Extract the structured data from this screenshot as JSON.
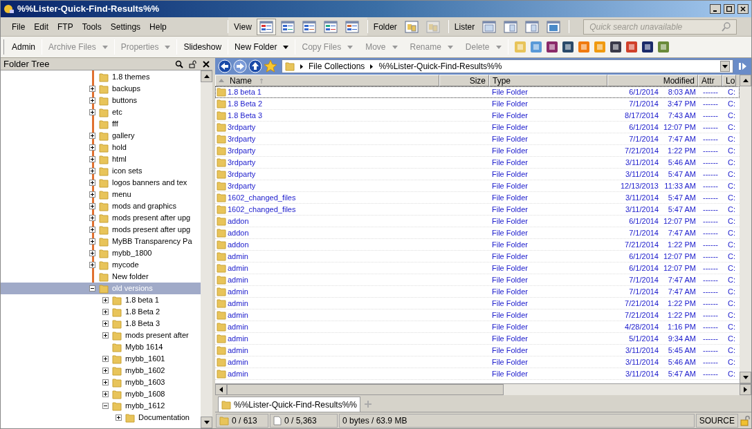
{
  "window": {
    "title": "%%Lister-Quick-Find-Results%%"
  },
  "menu": [
    "File",
    "Edit",
    "FTP",
    "Tools",
    "Settings",
    "Help"
  ],
  "view_group": {
    "label": "View",
    "modes": [
      {
        "selected": true
      },
      {
        "selected": false
      },
      {
        "selected": false
      },
      {
        "selected": false
      },
      {
        "selected": false
      }
    ]
  },
  "folder_group": {
    "label": "Folder",
    "buttons": [
      {
        "disabled": false
      },
      {
        "disabled": true
      }
    ]
  },
  "lister_group": {
    "label": "Lister"
  },
  "search": {
    "placeholder": "Quick search unavailable"
  },
  "toolbar": [
    {
      "label": "Admin",
      "disabled": false,
      "dropdown": false
    },
    {
      "label": "Archive Files",
      "disabled": true,
      "dropdown": true
    },
    {
      "label": "Properties",
      "disabled": true,
      "dropdown": true
    },
    {
      "label": "Slideshow",
      "disabled": false,
      "dropdown": false
    },
    {
      "label": "New Folder",
      "disabled": false,
      "dropdown": true
    },
    {
      "label": "Copy Files",
      "disabled": true,
      "dropdown": true
    },
    {
      "label": "Move",
      "disabled": true,
      "dropdown": true
    },
    {
      "label": "Rename",
      "disabled": true,
      "dropdown": true
    },
    {
      "label": "Delete",
      "disabled": true,
      "dropdown": true
    }
  ],
  "folder_tree": {
    "title": "Folder Tree",
    "items": [
      {
        "label": "1.8 themes",
        "expandable": false,
        "selected": false
      },
      {
        "label": "backups",
        "expandable": true,
        "expanded": false,
        "selected": false
      },
      {
        "label": "buttons",
        "expandable": true,
        "expanded": false,
        "selected": false
      },
      {
        "label": "etc",
        "expandable": true,
        "expanded": false,
        "selected": false
      },
      {
        "label": "fff",
        "expandable": false,
        "selected": false
      },
      {
        "label": "gallery",
        "expandable": true,
        "expanded": false,
        "selected": false
      },
      {
        "label": "hold",
        "expandable": true,
        "expanded": false,
        "selected": false
      },
      {
        "label": "html",
        "expandable": true,
        "expanded": false,
        "selected": false
      },
      {
        "label": "icon sets",
        "expandable": true,
        "expanded": false,
        "selected": false
      },
      {
        "label": "logos banners and tex",
        "expandable": true,
        "expanded": false,
        "selected": false
      },
      {
        "label": "menu",
        "expandable": true,
        "expanded": false,
        "selected": false
      },
      {
        "label": "mods and graphics",
        "expandable": true,
        "expanded": false,
        "selected": false
      },
      {
        "label": "mods present after upg",
        "expandable": true,
        "expanded": false,
        "selected": false
      },
      {
        "label": "mods present after upg",
        "expandable": true,
        "expanded": false,
        "selected": false
      },
      {
        "label": "MyBB Transparency Pa",
        "expandable": true,
        "expanded": false,
        "selected": false
      },
      {
        "label": "mybb_1800",
        "expandable": true,
        "expanded": false,
        "selected": false
      },
      {
        "label": "mycode",
        "expandable": true,
        "expanded": false,
        "selected": false
      },
      {
        "label": "New folder",
        "expandable": false,
        "selected": false
      },
      {
        "label": "old versions",
        "expandable": true,
        "expanded": true,
        "selected": true,
        "children": [
          {
            "label": "1.8 beta 1",
            "expandable": true,
            "expanded": false,
            "selected": false
          },
          {
            "label": "1.8 Beta 2",
            "expandable": true,
            "expanded": false,
            "selected": false
          },
          {
            "label": "1.8 Beta 3",
            "expandable": true,
            "expanded": false,
            "selected": false
          },
          {
            "label": "mods present after",
            "expandable": true,
            "expanded": false,
            "selected": false
          },
          {
            "label": "Mybb 1614",
            "expandable": false,
            "selected": false
          },
          {
            "label": "mybb_1601",
            "expandable": true,
            "expanded": false,
            "selected": false
          },
          {
            "label": "mybb_1602",
            "expandable": true,
            "expanded": false,
            "selected": false
          },
          {
            "label": "mybb_1603",
            "expandable": true,
            "expanded": false,
            "selected": false
          },
          {
            "label": "mybb_1608",
            "expandable": true,
            "expanded": false,
            "selected": false
          },
          {
            "label": "mybb_1612",
            "expandable": true,
            "expanded": true,
            "selected": false,
            "children": [
              {
                "label": "Documentation",
                "expandable": true,
                "expanded": false,
                "selected": false
              }
            ]
          }
        ]
      }
    ]
  },
  "breadcrumb": [
    "File Collections",
    "%%Lister-Quick-Find-Results%%"
  ],
  "file_list": {
    "columns": [
      "Name",
      "Size",
      "Type",
      "Modified",
      "Attr",
      "Lo"
    ],
    "rows": [
      {
        "name": "1.8 beta 1",
        "type": "File Folder",
        "date": "6/1/2014",
        "time": "8:03 AM",
        "attr": "------",
        "column_6": "C:"
      },
      {
        "name": "1.8 Beta 2",
        "type": "File Folder",
        "date": "7/1/2014",
        "time": "3:47 PM",
        "attr": "------",
        "column_6": "C:"
      },
      {
        "name": "1.8 Beta 3",
        "type": "File Folder",
        "date": "8/17/2014",
        "time": "7:43 AM",
        "attr": "------",
        "column_6": "C:"
      },
      {
        "name": "3rdparty",
        "type": "File Folder",
        "date": "6/1/2014",
        "time": "12:07 PM",
        "attr": "------",
        "column_6": "C:"
      },
      {
        "name": "3rdparty",
        "type": "File Folder",
        "date": "7/1/2014",
        "time": "7:47 AM",
        "attr": "------",
        "column_6": "C:"
      },
      {
        "name": "3rdparty",
        "type": "File Folder",
        "date": "7/21/2014",
        "time": "1:22 PM",
        "attr": "------",
        "column_6": "C:"
      },
      {
        "name": "3rdparty",
        "type": "File Folder",
        "date": "3/11/2014",
        "time": "5:46 AM",
        "attr": "------",
        "column_6": "C:"
      },
      {
        "name": "3rdparty",
        "type": "File Folder",
        "date": "3/11/2014",
        "time": "5:47 AM",
        "attr": "------",
        "column_6": "C:"
      },
      {
        "name": "3rdparty",
        "type": "File Folder",
        "date": "12/13/2013",
        "time": "11:33 AM",
        "attr": "------",
        "column_6": "C:"
      },
      {
        "name": "1602_changed_files",
        "type": "File Folder",
        "date": "3/11/2014",
        "time": "5:47 AM",
        "attr": "------",
        "column_6": "C:"
      },
      {
        "name": "1602_changed_files",
        "type": "File Folder",
        "date": "3/11/2014",
        "time": "5:47 AM",
        "attr": "------",
        "column_6": "C:"
      },
      {
        "name": "addon",
        "type": "File Folder",
        "date": "6/1/2014",
        "time": "12:07 PM",
        "attr": "------",
        "column_6": "C:"
      },
      {
        "name": "addon",
        "type": "File Folder",
        "date": "7/1/2014",
        "time": "7:47 AM",
        "attr": "------",
        "column_6": "C:"
      },
      {
        "name": "addon",
        "type": "File Folder",
        "date": "7/21/2014",
        "time": "1:22 PM",
        "attr": "------",
        "column_6": "C:"
      },
      {
        "name": "admin",
        "type": "File Folder",
        "date": "6/1/2014",
        "time": "12:07 PM",
        "attr": "------",
        "column_6": "C:"
      },
      {
        "name": "admin",
        "type": "File Folder",
        "date": "6/1/2014",
        "time": "12:07 PM",
        "attr": "------",
        "column_6": "C:"
      },
      {
        "name": "admin",
        "type": "File Folder",
        "date": "7/1/2014",
        "time": "7:47 AM",
        "attr": "------",
        "column_6": "C:"
      },
      {
        "name": "admin",
        "type": "File Folder",
        "date": "7/1/2014",
        "time": "7:47 AM",
        "attr": "------",
        "column_6": "C:"
      },
      {
        "name": "admin",
        "type": "File Folder",
        "date": "7/21/2014",
        "time": "1:22 PM",
        "attr": "------",
        "column_6": "C:"
      },
      {
        "name": "admin",
        "type": "File Folder",
        "date": "7/21/2014",
        "time": "1:22 PM",
        "attr": "------",
        "column_6": "C:"
      },
      {
        "name": "admin",
        "type": "File Folder",
        "date": "4/28/2014",
        "time": "1:16 PM",
        "attr": "------",
        "column_6": "C:"
      },
      {
        "name": "admin",
        "type": "File Folder",
        "date": "5/1/2014",
        "time": "9:34 AM",
        "attr": "------",
        "column_6": "C:"
      },
      {
        "name": "admin",
        "type": "File Folder",
        "date": "3/11/2014",
        "time": "5:45 AM",
        "attr": "------",
        "column_6": "C:"
      },
      {
        "name": "admin",
        "type": "File Folder",
        "date": "3/11/2014",
        "time": "5:46 AM",
        "attr": "------",
        "column_6": "C:"
      },
      {
        "name": "admin",
        "type": "File Folder",
        "date": "3/11/2014",
        "time": "5:47 AM",
        "attr": "------",
        "column_6": "C:"
      }
    ]
  },
  "tabs": [
    {
      "label": "%%Lister-Quick-Find-Results%%",
      "selected": true
    }
  ],
  "status_bar": {
    "folders": "0 / 613",
    "files": "0 / 5,363",
    "size": "0 bytes / 63.9 MB",
    "mode": "SOURCE"
  }
}
